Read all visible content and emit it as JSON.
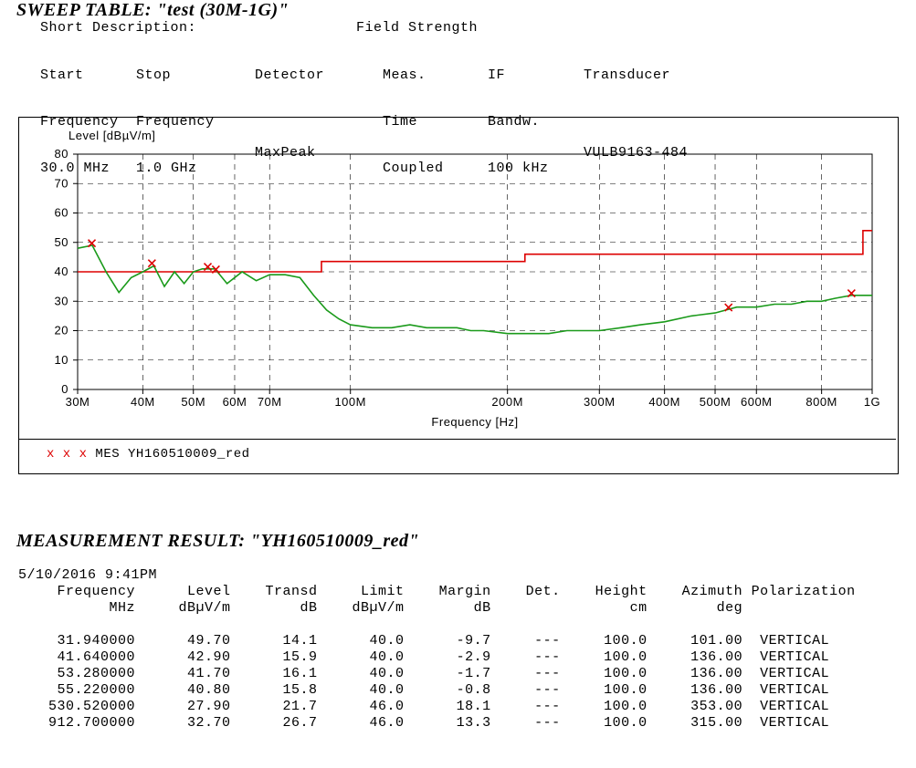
{
  "sweep": {
    "title": "SWEEP TABLE: \"test (30M-1G)\"",
    "short_desc_label": "Short Description:",
    "short_desc_value": "Field Strength",
    "cols": {
      "start": {
        "h1": "Start",
        "h2": "Frequency",
        "v": "30.0 MHz"
      },
      "stop": {
        "h1": "Stop",
        "h2": "Frequency",
        "v": "1.0 GHz"
      },
      "det": {
        "h1": "Detector",
        "h2": "",
        "v": "MaxPeak"
      },
      "meas": {
        "h1": "Meas.",
        "h2": "Time",
        "v": "Coupled"
      },
      "if": {
        "h1": "IF",
        "h2": "Bandw.",
        "v": "100 kHz"
      },
      "trans": {
        "h1": "Transducer",
        "h2": "",
        "v": "VULB9163-484"
      }
    }
  },
  "chart_data": {
    "type": "line",
    "title": "",
    "ylabel": "Level [dBµV/m]",
    "xlabel": "Frequency [Hz]",
    "ylim": [
      0,
      80
    ],
    "x_log": true,
    "xlim": [
      "30M",
      "1G"
    ],
    "x_ticks": [
      "30M",
      "40M",
      "50M",
      "60M",
      "70M",
      "100M",
      "200M",
      "300M",
      "400M",
      "500M",
      "600M",
      "800M",
      "1G"
    ],
    "y_ticks": [
      0,
      10,
      20,
      30,
      40,
      50,
      60,
      70,
      80
    ],
    "series": [
      {
        "name": "Limit",
        "color": "#d00",
        "kind": "step",
        "data": [
          {
            "x": 30,
            "y": 40
          },
          {
            "x": 88,
            "y": 40
          },
          {
            "x": 88,
            "y": 43.5
          },
          {
            "x": 216,
            "y": 43.5
          },
          {
            "x": 216,
            "y": 46
          },
          {
            "x": 960,
            "y": 46
          },
          {
            "x": 960,
            "y": 54
          },
          {
            "x": 1000,
            "y": 54
          }
        ]
      },
      {
        "name": "Trace",
        "color": "#1a9a1a",
        "kind": "line",
        "data": [
          {
            "x": 30,
            "y": 48
          },
          {
            "x": 32,
            "y": 49
          },
          {
            "x": 34,
            "y": 40
          },
          {
            "x": 36,
            "y": 33
          },
          {
            "x": 38,
            "y": 38
          },
          {
            "x": 40,
            "y": 40
          },
          {
            "x": 42,
            "y": 42
          },
          {
            "x": 44,
            "y": 35
          },
          {
            "x": 46,
            "y": 40
          },
          {
            "x": 48,
            "y": 36
          },
          {
            "x": 50,
            "y": 40
          },
          {
            "x": 52,
            "y": 41
          },
          {
            "x": 55,
            "y": 41
          },
          {
            "x": 58,
            "y": 36
          },
          {
            "x": 62,
            "y": 40
          },
          {
            "x": 66,
            "y": 37
          },
          {
            "x": 70,
            "y": 39
          },
          {
            "x": 75,
            "y": 39
          },
          {
            "x": 80,
            "y": 38
          },
          {
            "x": 85,
            "y": 32
          },
          {
            "x": 90,
            "y": 27
          },
          {
            "x": 95,
            "y": 24
          },
          {
            "x": 100,
            "y": 22
          },
          {
            "x": 110,
            "y": 21
          },
          {
            "x": 120,
            "y": 21
          },
          {
            "x": 130,
            "y": 22
          },
          {
            "x": 140,
            "y": 21
          },
          {
            "x": 150,
            "y": 21
          },
          {
            "x": 160,
            "y": 21
          },
          {
            "x": 170,
            "y": 20
          },
          {
            "x": 180,
            "y": 20
          },
          {
            "x": 200,
            "y": 19
          },
          {
            "x": 220,
            "y": 19
          },
          {
            "x": 240,
            "y": 19
          },
          {
            "x": 260,
            "y": 20
          },
          {
            "x": 280,
            "y": 20
          },
          {
            "x": 300,
            "y": 20
          },
          {
            "x": 330,
            "y": 21
          },
          {
            "x": 360,
            "y": 22
          },
          {
            "x": 400,
            "y": 23
          },
          {
            "x": 450,
            "y": 25
          },
          {
            "x": 500,
            "y": 26
          },
          {
            "x": 550,
            "y": 28
          },
          {
            "x": 600,
            "y": 28
          },
          {
            "x": 650,
            "y": 29
          },
          {
            "x": 700,
            "y": 29
          },
          {
            "x": 750,
            "y": 30
          },
          {
            "x": 800,
            "y": 30
          },
          {
            "x": 850,
            "y": 31
          },
          {
            "x": 912,
            "y": 32
          },
          {
            "x": 950,
            "y": 32
          },
          {
            "x": 1000,
            "y": 32
          }
        ]
      }
    ],
    "markers": [
      {
        "x": 31.94,
        "y": 49.7
      },
      {
        "x": 41.64,
        "y": 42.9
      },
      {
        "x": 53.28,
        "y": 41.7
      },
      {
        "x": 55.22,
        "y": 40.8
      },
      {
        "x": 530.52,
        "y": 27.9
      },
      {
        "x": 912.7,
        "y": 32.7
      }
    ],
    "legend": {
      "marker": "x  x  x",
      "label": "MES   YH160510009_red"
    }
  },
  "measurement": {
    "title": "MEASUREMENT RESULT: \"YH160510009_red\"",
    "timestamp": "5/10/2016  9:41PM",
    "headers": [
      "Frequency",
      "Level",
      "Transd",
      "Limit",
      "Margin",
      "Det.",
      "Height",
      "Azimuth",
      "Polarization"
    ],
    "units": [
      "MHz",
      "dBµV/m",
      "dB",
      "dBµV/m",
      "dB",
      "",
      "cm",
      "deg",
      ""
    ],
    "rows": [
      {
        "freq": "31.940000",
        "level": "49.70",
        "transd": "14.1",
        "limit": "40.0",
        "margin": "-9.7",
        "det": "---",
        "height": "100.0",
        "azimuth": "101.00",
        "pol": "VERTICAL"
      },
      {
        "freq": "41.640000",
        "level": "42.90",
        "transd": "15.9",
        "limit": "40.0",
        "margin": "-2.9",
        "det": "---",
        "height": "100.0",
        "azimuth": "136.00",
        "pol": "VERTICAL"
      },
      {
        "freq": "53.280000",
        "level": "41.70",
        "transd": "16.1",
        "limit": "40.0",
        "margin": "-1.7",
        "det": "---",
        "height": "100.0",
        "azimuth": "136.00",
        "pol": "VERTICAL"
      },
      {
        "freq": "55.220000",
        "level": "40.80",
        "transd": "15.8",
        "limit": "40.0",
        "margin": "-0.8",
        "det": "---",
        "height": "100.0",
        "azimuth": "136.00",
        "pol": "VERTICAL"
      },
      {
        "freq": "530.520000",
        "level": "27.90",
        "transd": "21.7",
        "limit": "46.0",
        "margin": "18.1",
        "det": "---",
        "height": "100.0",
        "azimuth": "353.00",
        "pol": "VERTICAL"
      },
      {
        "freq": "912.700000",
        "level": "32.70",
        "transd": "26.7",
        "limit": "46.0",
        "margin": "13.3",
        "det": "---",
        "height": "100.0",
        "azimuth": "315.00",
        "pol": "VERTICAL"
      }
    ]
  }
}
